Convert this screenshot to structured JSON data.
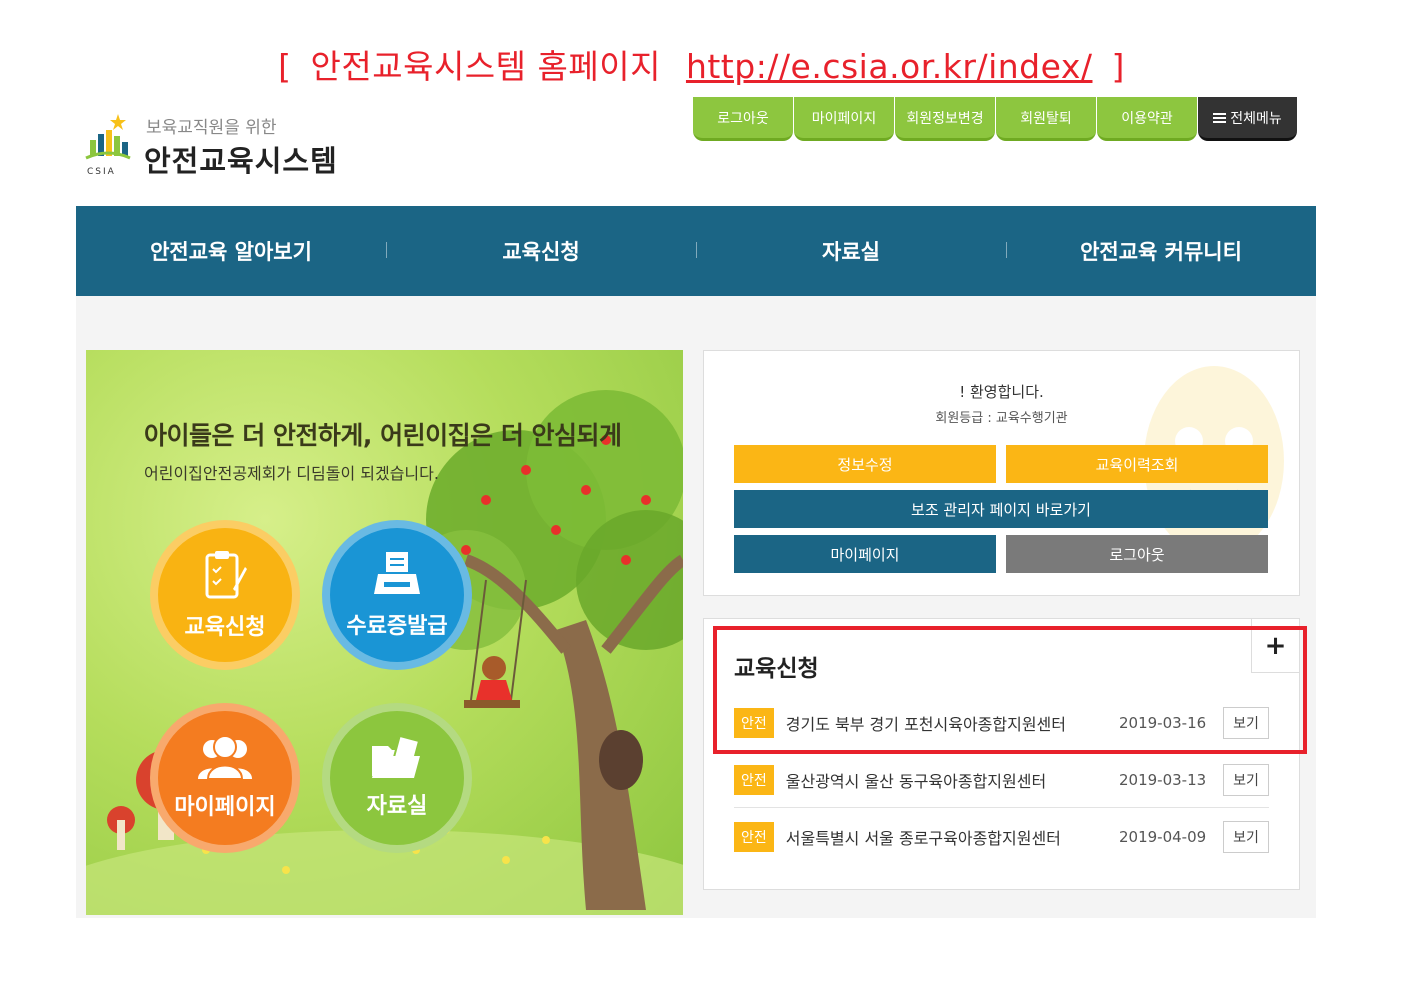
{
  "caption": {
    "bracket_open": "[",
    "title": "안전교육시스템 홈페이지",
    "url": "http://e.csia.or.kr/index/",
    "bracket_close": "]",
    "color": "#e8212b"
  },
  "logo": {
    "subtitle": "보육교직원을 위한",
    "title": "안전교육시스템",
    "mark_text": "CSIA"
  },
  "top_menu": [
    {
      "label": "로그아웃"
    },
    {
      "label": "마이페이지"
    },
    {
      "label": "회원정보변경"
    },
    {
      "label": "회원탈퇴"
    },
    {
      "label": "이용약관"
    },
    {
      "label": "전체메뉴",
      "icon": "hamburger-icon"
    }
  ],
  "gnb": [
    {
      "label": "안전교육 알아보기"
    },
    {
      "label": "교육신청"
    },
    {
      "label": "자료실"
    },
    {
      "label": "안전교육 커뮤니티"
    }
  ],
  "banner": {
    "headline": "아이들은 더 안전하게, 어린이집은 더 안심되게",
    "subline": "어린이집안전공제회가 디딤돌이 되겠습니다.",
    "quick_links": [
      {
        "label": "교육신청",
        "icon": "clipboard-icon",
        "color": "#f9b312"
      },
      {
        "label": "수료증발급",
        "icon": "printer-icon",
        "color": "#1a95d5"
      },
      {
        "label": "마이페이지",
        "icon": "users-icon",
        "color": "#f47c20"
      },
      {
        "label": "자료실",
        "icon": "folder-icon",
        "color": "#8cc63e"
      }
    ]
  },
  "login_box": {
    "welcome": "! 환영합니다.",
    "grade": "회원등급 : 교육수행기관",
    "buttons": {
      "edit_info": "정보수정",
      "history": "교육이력조회",
      "sub_admin": "보조 관리자 페이지 바로가기",
      "mypage": "마이페이지",
      "logout": "로그아웃"
    }
  },
  "edu_list": {
    "title": "교육신청",
    "more": "+",
    "rows": [
      {
        "tag": "안전",
        "name": "경기도 북부 경기 포천시육아종합지원센터",
        "date": "2019-03-16",
        "action": "보기"
      },
      {
        "tag": "안전",
        "name": "울산광역시 울산 동구육아종합지원센터",
        "date": "2019-03-13",
        "action": "보기"
      },
      {
        "tag": "안전",
        "name": "서울특별시 서울 종로구육아종합지원센터",
        "date": "2019-04-09",
        "action": "보기"
      }
    ]
  },
  "colors": {
    "brand_blue": "#1b6585",
    "menu_green": "#8dc63f",
    "accent_yellow": "#fbb615",
    "highlight_red": "#e8212b"
  }
}
